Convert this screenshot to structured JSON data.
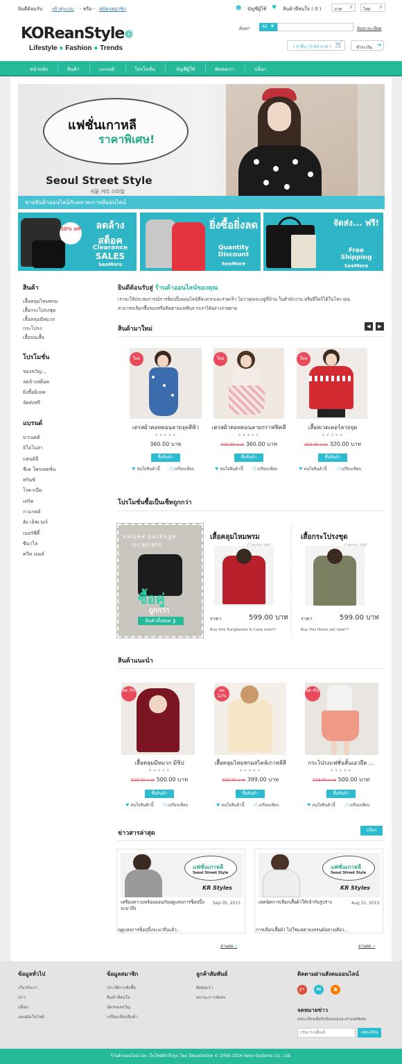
{
  "topbar": {
    "welcome": "ยินดีต้อนรับ",
    "login": "เข้าสู่ระบบ",
    "or": "- หรือ -",
    "register": "สมัครสมาชิก",
    "account": "บัญชีผู้ใช้",
    "wishlist": "สินค้าที่สนใจ ( 0 )",
    "currency": "บาท",
    "language": "ไทย",
    "search_label": "ค้นหา",
    "search_scope": "All",
    "advanced_search": "ค้นหาละเอียด",
    "cart": "( 0 ชิ้น / 0.00 บาท )",
    "checkout": "ชำระเงิน"
  },
  "logo": {
    "name": "KOReanStyle",
    "sub1": "Lifestyle",
    "sub2": "Fashion",
    "sub3": "Trends"
  },
  "nav": [
    "หน้าหลัก",
    "สินค้า",
    "แบรนด์",
    "โปรโมชั่น",
    "บัญชีผู้ใช้",
    "ติดต่อเรา",
    "บล็อก"
  ],
  "hero": {
    "line1": "แฟชั่นเกาหลี",
    "line2": "ราคาพิเศษ!",
    "street": "Seoul Street Style",
    "korean": "서울 거리 스타일",
    "caption": "ขายสินค้าออนไลน์กับตลาดเกาหลีออนไลน์"
  },
  "promos": [
    {
      "badge": "30% off",
      "th": "ลดล้างสต็อค",
      "en1": "Clearance",
      "en2": "SALES",
      "more": "SeeMore"
    },
    {
      "th": "ยิ่งซื้อยิ่งลด",
      "en1": "Quantity",
      "en2": "Discount",
      "more": "SeeMore"
    },
    {
      "th": "จัดส่ง... ฟรี!",
      "en1": "Free",
      "en2": "Shipping",
      "more": "SeeMore"
    }
  ],
  "sidebar": {
    "products_title": "สินค้า",
    "products": [
      "เสื้อคลุมไหมพรม",
      "เสื้อกระโปรงชุด",
      "เสื้อคลุมมีหมวก",
      "กระโปรง",
      "เสื้อบนเสื้อ"
    ],
    "promo_title": "โปรโมชั่น",
    "promos": [
      "ของขวัญ...",
      "ลดล้างสต็อค",
      "ยิ่งซื้อยิ่งลด",
      "จัดส่งฟรี"
    ],
    "brand_title": "แบรนด์",
    "brands": [
      "บาเนตต์",
      "จิโอโนล่า",
      "แฮนด์อี",
      "ขีเค โพรเทคชั่น",
      "ทรินซ์",
      "โรดาเนีย",
      "เทริค",
      "กาแรตต์",
      "ฮัง เล็ฟเวอร์",
      "เมอร์ซี่ดี้",
      "ซีนาโล",
      "ควีท เจมส์"
    ]
  },
  "intro": {
    "title_a": "ยินดีต้อนรับสู่",
    "title_b": "ร้านค้าออนไลน์ของคุณ",
    "text1": "เราจะให้ประสบการณ์การช็อปปิ้งออนไลน์ที่สะดวกและรวดเร็ว  ไม่ว่าคุณจะอยู่ที่บ้าน  ในสำนักงาน  หรือที่ใดก็ได้ในโลก  คุณ",
    "text2": "สามารถเลือกซื้อของหรือติดตามแฟชั่นจากเราได้อย่างง่ายดาย"
  },
  "new_products": {
    "title": "สินค้ามาใหม่",
    "items": [
      {
        "badge": "ใหม่",
        "name": "เดรสผ้าคอทตอนลายจุดสีฟ้า",
        "old": "",
        "price": "360.00 บาท"
      },
      {
        "badge": "ใหม่",
        "name": "เดรสผ้าคอทตอนลายกราฟฟิคสี",
        "old": "400.00 บาท",
        "price": "360.00 บาท"
      },
      {
        "badge": "ใหม่",
        "name": "เสื้อสเวตเตอร์ลายจุด",
        "old": "350.00 บาท",
        "price": "320.00 บาท"
      }
    ]
  },
  "labels": {
    "buy": "ซื้อสินค้า",
    "wish": "สนใจสินค้านี้",
    "compare": "เปรียบเทียบ",
    "stars": "★★★★★",
    "price_label": "ราคา",
    "read_more": "อ่านต่อ"
  },
  "sets": {
    "title": "โปรโมชั่นซื้อเป็นเซ็ทถูกกว่า",
    "banner_top": "valuea package",
    "banner_kr": "한국 패션 패키지",
    "banner_big": "ซื้อคู่",
    "banner_mid": "ถูกกว่า",
    "banner_btn": "สินค้าทั้งหมด",
    "items": [
      {
        "name": "เสื้อคลุมไหมพรม",
        "tag": "Combo Set",
        "price": "599.00 บาท",
        "desc": "Buy this Sunglasses &  Case now!!!"
      },
      {
        "name": "เสื้อกระโปรงชุด",
        "tag": "Combo Set",
        "price": "599.00 บาท",
        "desc": "Buy this Dress set now!!!"
      }
    ]
  },
  "recommended": {
    "title": "สินค้าแนะนำ",
    "items": [
      {
        "badge": "ลด 3%",
        "name": "เสื้อคลุมมีหมวก มีซิป",
        "old": "515.00 บาท",
        "price": "500.00 บาท"
      },
      {
        "badge": "ลด 12%",
        "name": "เสื้อคลุมไหมพรมสไตล์เกาหลีสี",
        "old": "450.00 บาท",
        "price": "399.00 บาท"
      },
      {
        "badge": "ลด 4%",
        "name": "กระโปรงแฟชั่นสั้นเอวยืด ...",
        "old": "516.00 บาท",
        "price": "500.00 บาท"
      }
    ]
  },
  "news": {
    "title": "ข่าวสารล่าสุด",
    "blog_btn": "บล็อก",
    "items": [
      {
        "headline": "เตรียมความพร้อมออนกับฤดูแห่งการช็อปปิ้งจะมาถึง",
        "date": "Sep 05, 2013",
        "excerpt": "ฤดูแห่งการช็อปปิ้งจะมาถึงแล้ว...",
        "banner_a": "แฟชั่นเกาหลี",
        "banner_b": "Seoul Street Style",
        "brand": "KR Styles"
      },
      {
        "headline": "เทคนิคการเลือกเสื้อผ้าให้เข้ากับรูปร่าง",
        "date": "Aug 31, 2013",
        "excerpt": "การเลือกเสื้อผ้า ไม่ใช่แค่ตามเทรนด์อย่างเดียว...",
        "banner_a": "แฟชั่นเกาหลี",
        "banner_b": "Seoul Street Style",
        "brand": "KR Styles"
      }
    ]
  },
  "footer": {
    "col1_title": "ข้อมูลทั่วไป",
    "col1": [
      "เกี่ยวกับเรา",
      "ข่าว",
      "บล็อก",
      "แผนผังเว็บไซต์"
    ],
    "col2_title": "ข้อมูลสมาชิก",
    "col2": [
      "ประวัติการสั่งซื้อ",
      "สินค้าที่สนใจ",
      "บัตรของขวัญ",
      "เปรียบเทียบสินค้า"
    ],
    "col3_title": "ลูกค้าสัมพันธ์",
    "col3": [
      "ติดต่อเรา",
      "สถานะการจัดส่ง"
    ],
    "social_title": "ติดตามผ่านสังคมออนไลน์",
    "newsletter_title": "จดหมายข่าว",
    "newsletter_text": "ลงทะเบียนเพื่อรับข้อเสนอและส่วนลดพิเศษ",
    "email_placeholder": "กรุณาระบุอีเมล์",
    "subscribe": "ลงทะเบียน",
    "copyright": "ร้านค้าออนไลน์ และ เว็บไซต์สำเร็จรูป โดย TakraOnline © 2006-2014 Vevo Systems Co., Ltd."
  },
  "colors": {
    "accent": "#26b99a",
    "cyan": "#2bbcd0",
    "sale": "#e84c5c"
  }
}
